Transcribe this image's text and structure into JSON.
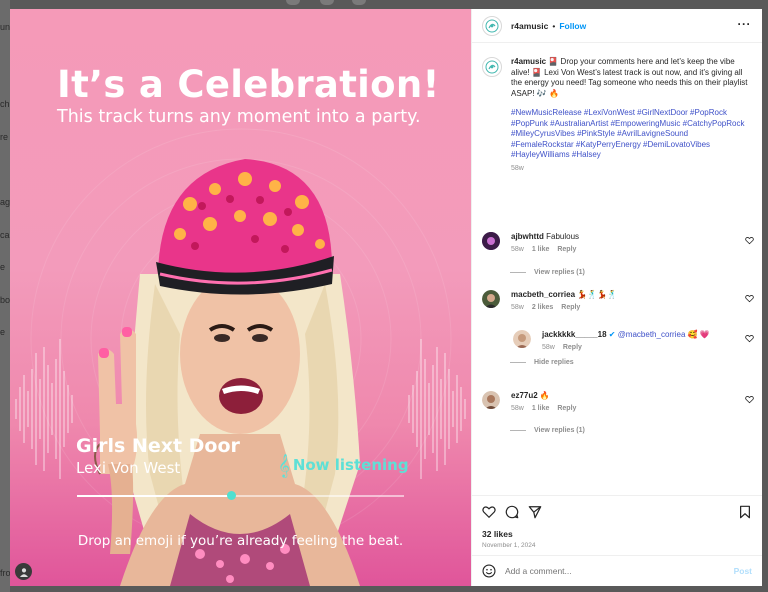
{
  "background": {
    "left_fragments": [
      "un",
      "",
      "ch",
      "re",
      "",
      "ag",
      "ca",
      "e",
      "bo",
      "e",
      "fro"
    ]
  },
  "post": {
    "media": {
      "headline": "It’s a Celebration!",
      "subheadline": "This track turns any moment into a party.",
      "track_title": "Girls Next Door",
      "track_artist": "Lexi Von West",
      "now_listening": "Now listening",
      "progress": 0.47,
      "cta": "Drop an emoji if you’re already feeling the beat.",
      "colors": {
        "gradient_top": "#f59ab8",
        "gradient_bottom": "#e0559a",
        "accent": "#5ee0d6"
      }
    },
    "header": {
      "username": "r4amusic",
      "separator": "•",
      "follow_label": "Follow",
      "more_label": "···"
    },
    "caption": {
      "username": "r4amusic",
      "text": "🎴 Drop your comments here and let’s keep the vibe alive! 🎴 Lexi Von West’s latest track is out now, and it’s giving all the energy you need! Tag someone who needs this on their playlist ASAP! 🎶 🔥",
      "hashtags": "#NewMusicRelease #LexiVonWest #GirlNextDoor #PopRock #PopPunk #AustralianArtist #EmpoweringMusic #CatchyPopRock #MileyCyrusVibes #PinkStyle #AvrilLavigneSound #FemaleRockstar #KatyPerryEnergy #DemiLovatoVibes #HayleyWilliams #Halsey",
      "time": "58w"
    },
    "comments": [
      {
        "username": "ajbwhttd",
        "text": "Fabulous",
        "time": "58w",
        "likes": "1 like",
        "reply": "Reply",
        "view_replies": "View replies (1)",
        "avatar_color": "#5a2b6e"
      },
      {
        "username": "macbeth_corriea",
        "text": "💃🕺💃🕺",
        "time": "58w",
        "likes": "2 likes",
        "reply": "Reply",
        "avatar_color": "#4b5b3a"
      },
      {
        "username": "jackkkkk_____18",
        "mention": "@macbeth_corriea",
        "text": "🥰 💗",
        "time": "58w",
        "reply": "Reply",
        "hide_replies": "Hide replies",
        "avatar_color": "#c9a58c"
      },
      {
        "username": "ez77u2",
        "text": "🔥",
        "time": "58w",
        "likes": "1 like",
        "reply": "Reply",
        "view_replies": "View replies (1)",
        "avatar_color": "#b88f76"
      }
    ],
    "likes": "32 likes",
    "date": "November 1, 2024",
    "add_comment_placeholder": "Add a comment...",
    "post_label": "Post"
  }
}
